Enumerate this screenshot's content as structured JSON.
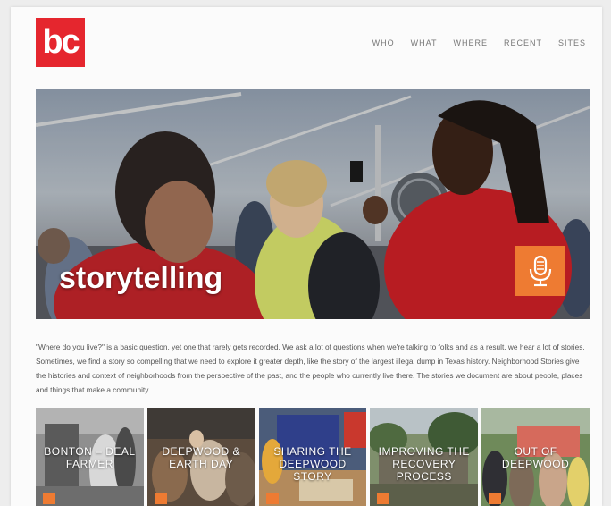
{
  "brand": {
    "logo_text": "bc",
    "logo_color": "#e5262e"
  },
  "nav": {
    "items": [
      "WHO",
      "WHAT",
      "WHERE",
      "RECENT",
      "SITES"
    ]
  },
  "hero": {
    "title": "storytelling",
    "action_icon": "microphone-icon",
    "accent_color": "#ee7b32"
  },
  "intro": {
    "text": "\"Where do you live?\" is a basic question, yet one that rarely gets recorded. We ask a lot of questions when we're talking to folks and as a result, we hear a lot of stories. Sometimes, we find a story so compelling that we need to explore it greater depth, like the story of the largest illegal dump in Texas history. Neighborhood Stories give the histories and context of neighborhoods from the perspective of the past, and the people who currently live there. The stories we document are about people, places and things that make a community."
  },
  "tiles": [
    {
      "label": "BONTON – DEAL FARMER",
      "icon": "microphone-icon"
    },
    {
      "label": "DEEPWOOD & EARTH DAY",
      "icon": "microphone-icon"
    },
    {
      "label": "SHARING THE DEEPWOOD STORY",
      "icon": "microphone-icon"
    },
    {
      "label": "IMPROVING THE RECOVERY PROCESS",
      "icon": "microphone-icon"
    },
    {
      "label": "OUT OF DEEPWOOD",
      "icon": "microphone-icon"
    }
  ]
}
